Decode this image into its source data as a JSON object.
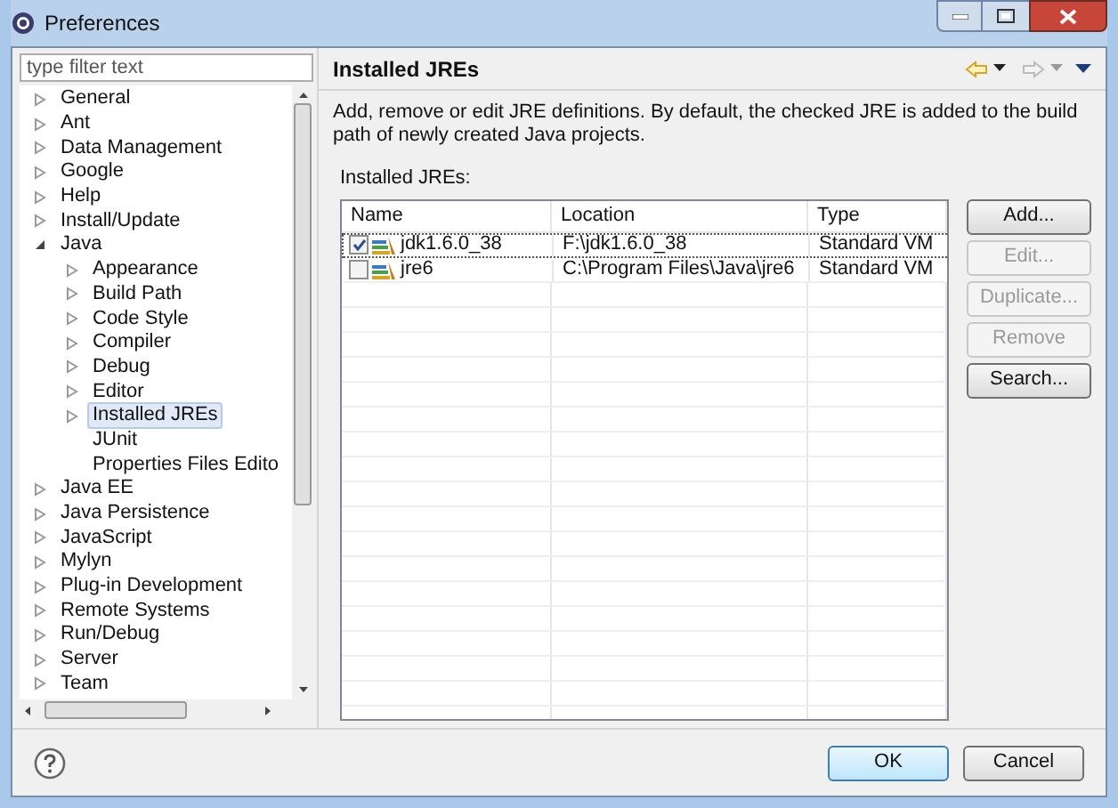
{
  "window": {
    "title": "Preferences"
  },
  "filter": {
    "placeholder": "type filter text"
  },
  "tree": [
    {
      "label": "General",
      "expandable": true,
      "expanded": false,
      "selected": false
    },
    {
      "label": "Ant",
      "expandable": true,
      "expanded": false,
      "selected": false
    },
    {
      "label": "Data Management",
      "expandable": true,
      "expanded": false,
      "selected": false
    },
    {
      "label": "Google",
      "expandable": true,
      "expanded": false,
      "selected": false
    },
    {
      "label": "Help",
      "expandable": true,
      "expanded": false,
      "selected": false
    },
    {
      "label": "Install/Update",
      "expandable": true,
      "expanded": false,
      "selected": false
    },
    {
      "label": "Java",
      "expandable": true,
      "expanded": true,
      "selected": false,
      "children": [
        {
          "label": "Appearance",
          "expandable": true,
          "expanded": false,
          "selected": false
        },
        {
          "label": "Build Path",
          "expandable": true,
          "expanded": false,
          "selected": false
        },
        {
          "label": "Code Style",
          "expandable": true,
          "expanded": false,
          "selected": false
        },
        {
          "label": "Compiler",
          "expandable": true,
          "expanded": false,
          "selected": false
        },
        {
          "label": "Debug",
          "expandable": true,
          "expanded": false,
          "selected": false
        },
        {
          "label": "Editor",
          "expandable": true,
          "expanded": false,
          "selected": false
        },
        {
          "label": "Installed JREs",
          "expandable": true,
          "expanded": false,
          "selected": true
        },
        {
          "label": "JUnit",
          "expandable": false,
          "expanded": false,
          "selected": false
        },
        {
          "label": "Properties Files Edito",
          "expandable": false,
          "expanded": false,
          "selected": false
        }
      ]
    },
    {
      "label": "Java EE",
      "expandable": true,
      "expanded": false,
      "selected": false
    },
    {
      "label": "Java Persistence",
      "expandable": true,
      "expanded": false,
      "selected": false
    },
    {
      "label": "JavaScript",
      "expandable": true,
      "expanded": false,
      "selected": false
    },
    {
      "label": "Mylyn",
      "expandable": true,
      "expanded": false,
      "selected": false
    },
    {
      "label": "Plug-in Development",
      "expandable": true,
      "expanded": false,
      "selected": false
    },
    {
      "label": "Remote Systems",
      "expandable": true,
      "expanded": false,
      "selected": false
    },
    {
      "label": "Run/Debug",
      "expandable": true,
      "expanded": false,
      "selected": false
    },
    {
      "label": "Server",
      "expandable": true,
      "expanded": false,
      "selected": false
    },
    {
      "label": "Team",
      "expandable": true,
      "expanded": false,
      "selected": false
    }
  ],
  "page": {
    "title": "Installed JREs",
    "description": "Add, remove or edit JRE definitions. By default, the checked JRE is added to the build path of newly created Java projects.",
    "list_label": "Installed JREs:"
  },
  "table": {
    "columns": [
      "Name",
      "Location",
      "Type"
    ],
    "rows": [
      {
        "name": "jdk1.6.0_38",
        "location": "F:\\jdk1.6.0_38",
        "type": "Standard VM",
        "checked": true,
        "selected": true
      },
      {
        "name": "jre6",
        "location": "C:\\Program Files\\Java\\jre6",
        "type": "Standard VM",
        "checked": false,
        "selected": false
      }
    ]
  },
  "side_buttons": [
    {
      "label": "Add...",
      "disabled": false
    },
    {
      "label": "Edit...",
      "disabled": true
    },
    {
      "label": "Duplicate...",
      "disabled": true
    },
    {
      "label": "Remove",
      "disabled": true
    },
    {
      "label": "Search...",
      "disabled": false
    }
  ],
  "footer_buttons": [
    {
      "label": "OK",
      "default": true
    },
    {
      "label": "Cancel",
      "default": false
    }
  ]
}
